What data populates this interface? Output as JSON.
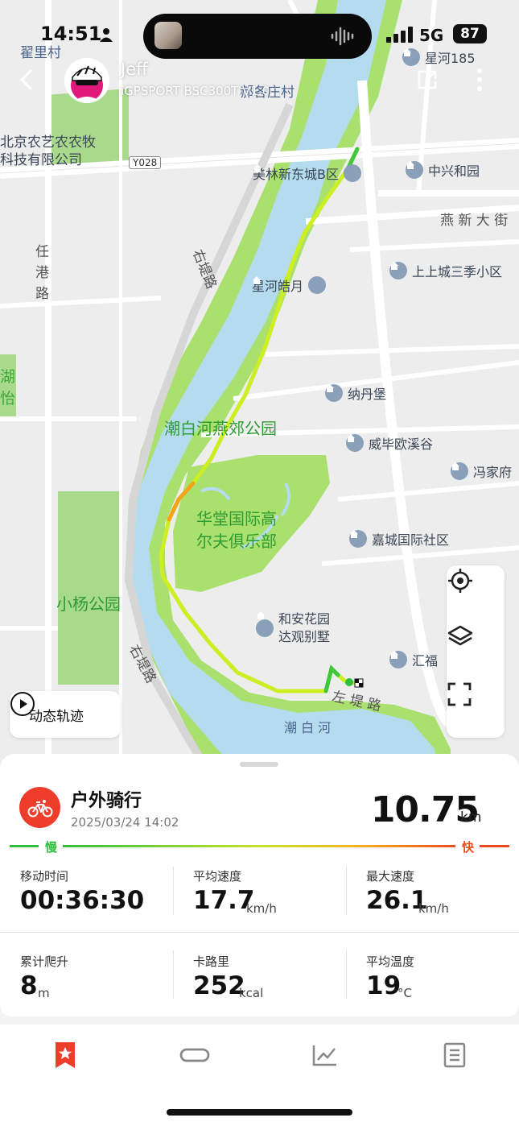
{
  "status_bar": {
    "time": "14:51",
    "network": "5G",
    "battery": "87"
  },
  "header": {
    "user_name": "Jeff",
    "device": "iGPSPORT BSC300T V1.0",
    "back_icon": "chevron-left-icon",
    "share_icon": "share-icon",
    "more_icon": "more-vertical-icon"
  },
  "map": {
    "labels": {
      "village1": "翟里村",
      "village2": "郝各庄村",
      "company_line1": "北京农艺农农牧",
      "company_line2": "科技有限公司",
      "road_code": "Y028",
      "road_right_upper": "右堤路",
      "road_left_v": "任港路",
      "road_yanxin": "燕 新 大 街",
      "park": "潮白河燕郊公园",
      "golf_line1": "华堂国际高",
      "golf_line2": "尔夫俱乐部",
      "yang_park": "小杨公园",
      "road_right_lower": "右堤路",
      "road_zuodi": "左 堤 路",
      "river": "潮 白 河",
      "edge_lake_1": "湖",
      "edge_lake_2": "怡"
    },
    "pois": [
      {
        "name": "星河185"
      },
      {
        "name": "美林新东城B区"
      },
      {
        "name": "中兴和园"
      },
      {
        "name": "上上城三季小区"
      },
      {
        "name": "星河皓月"
      },
      {
        "name": "纳丹堡"
      },
      {
        "name": "威毕欧溪谷"
      },
      {
        "name": "冯家府"
      },
      {
        "name": "嘉城国际社区"
      },
      {
        "name": "和安花园"
      },
      {
        "name": "达观别墅"
      },
      {
        "name": "汇福"
      }
    ],
    "replay_label": "动态轨迹",
    "controls": [
      "locate-icon",
      "layers-icon",
      "fullscreen-icon"
    ]
  },
  "activity": {
    "type": "户外骑行",
    "datetime": "2025/03/24 14:02",
    "distance": "10.75",
    "distance_unit": "km",
    "speed_scale": {
      "slow": "慢",
      "fast": "快"
    },
    "colors": {
      "accent": "#ef3d2c",
      "slow": "#2fbf3f",
      "fast": "#ef4a1f"
    }
  },
  "stats": [
    {
      "label": "移动时间",
      "value": "00:36:30",
      "unit": ""
    },
    {
      "label": "平均速度",
      "value": "17.7",
      "unit": "km/h"
    },
    {
      "label": "最大速度",
      "value": "26.1",
      "unit": "km/h"
    },
    {
      "label": "累计爬升",
      "value": "8",
      "unit": "m"
    },
    {
      "label": "卡路里",
      "value": "252",
      "unit": "kcal"
    },
    {
      "label": "平均温度",
      "value": "19",
      "unit": "°C"
    }
  ],
  "tabs": [
    {
      "icon": "star-bookmark-icon",
      "active": true
    },
    {
      "icon": "segment-loop-icon",
      "active": false
    },
    {
      "icon": "chart-icon",
      "active": false
    },
    {
      "icon": "document-icon",
      "active": false
    }
  ]
}
